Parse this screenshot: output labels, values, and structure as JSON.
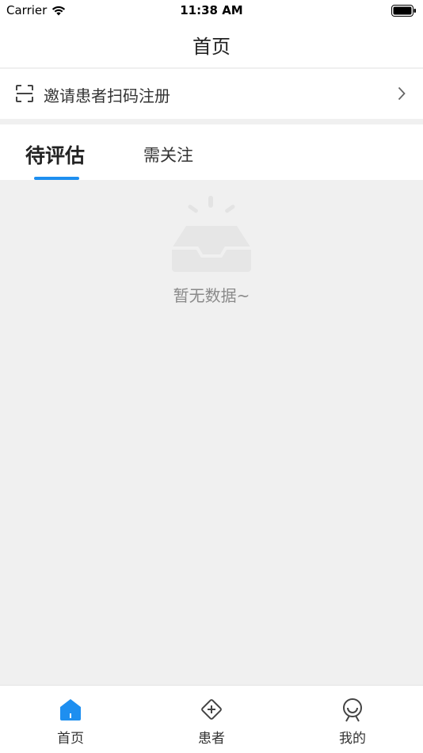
{
  "status_bar": {
    "carrier": "Carrier",
    "time": "11:38 AM"
  },
  "nav": {
    "title": "首页"
  },
  "invite": {
    "label": "邀请患者扫码注册",
    "icon": "scan-icon"
  },
  "tabs": {
    "items": [
      {
        "label": "待评估",
        "active": true
      },
      {
        "label": "需关注",
        "active": false
      }
    ],
    "accent_color": "#1e8ff0"
  },
  "empty_state": {
    "text": "暂无数据~",
    "icon": "empty-inbox-icon"
  },
  "tab_bar": {
    "items": [
      {
        "label": "首页",
        "icon": "home-icon",
        "active": true
      },
      {
        "label": "患者",
        "icon": "patient-icon",
        "active": false
      },
      {
        "label": "我的",
        "icon": "profile-icon",
        "active": false
      }
    ]
  },
  "colors": {
    "accent": "#1e8ff0",
    "background": "#f0f0f0"
  }
}
